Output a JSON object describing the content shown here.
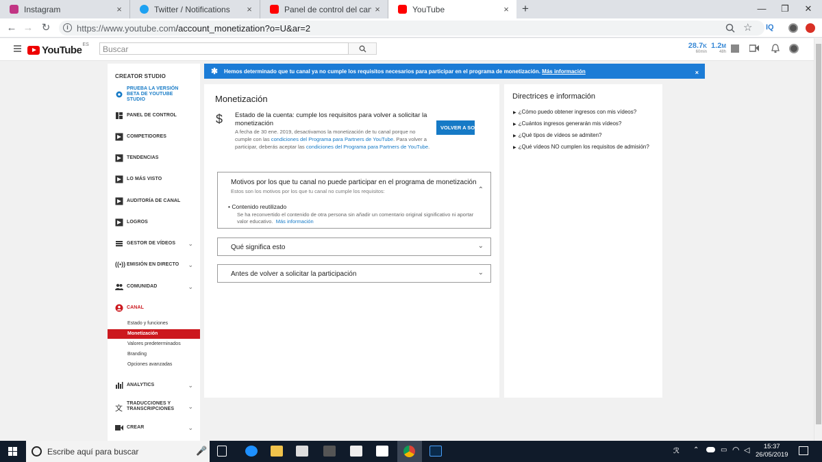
{
  "browser": {
    "tabs": [
      {
        "label": "Instagram",
        "favicon_color": "#c13584"
      },
      {
        "label": "Twitter / Notifications",
        "favicon_color": "#1da1f2"
      },
      {
        "label": "Panel de control del canal - YouTu",
        "favicon_color": "#ff0000"
      },
      {
        "label": "YouTube",
        "favicon_color": "#ff0000"
      }
    ],
    "close_glyph": "×",
    "new_tab_glyph": "+",
    "window_controls": [
      "—",
      "❐",
      "✕"
    ],
    "url_host": "https://www.youtube.com",
    "url_path": "/account_monetization?o=U&ar=2",
    "extension_label": "IQ"
  },
  "youtube": {
    "logo_text": "YouTube",
    "country_code": "ES",
    "search_placeholder": "Buscar",
    "stats": [
      {
        "value": "28.7",
        "unit": "K",
        "label": "60min"
      },
      {
        "value": "1.2",
        "unit": "M",
        "label": "48h"
      }
    ]
  },
  "sidebar": {
    "title": "CREATOR STUDIO",
    "beta_label": "PRUEBA LA VERSIÓN BETA DE YOUTUBE STUDIO",
    "items": [
      {
        "label": "PANEL DE CONTROL",
        "icon": "dashboard-icon"
      },
      {
        "label": "COMPETIDORES",
        "icon": "extension-icon"
      },
      {
        "label": "TENDENCIAS",
        "icon": "extension-icon"
      },
      {
        "label": "LO MÁS VISTO",
        "icon": "extension-icon"
      },
      {
        "label": "AUDITORÍA DE CANAL",
        "icon": "extension-icon"
      },
      {
        "label": "LOGROS",
        "icon": "extension-icon"
      },
      {
        "label": "GESTOR DE VÍDEOS",
        "icon": "video-manager-icon"
      },
      {
        "label": "EMISIÓN EN DIRECTO",
        "icon": "live-icon"
      },
      {
        "label": "COMUNIDAD",
        "icon": "community-icon"
      },
      {
        "label": "CANAL",
        "icon": "channel-icon"
      },
      {
        "label": "ANALYTICS",
        "icon": "analytics-icon"
      },
      {
        "label": "TRADUCCIONES Y TRANSCRIPCIONES",
        "icon": "translate-icon"
      },
      {
        "label": "CREAR",
        "icon": "create-icon"
      }
    ],
    "canal_subitems": [
      "Estado y funciones",
      "Monetización",
      "Valores predeterminados",
      "Branding",
      "Opciones avanzadas"
    ],
    "active_subitem": "Monetización"
  },
  "banner": {
    "text": "Hemos determinado que tu canal ya no cumple los requisitos necesarios para participar en el programa de monetización.",
    "link": "Más información",
    "close": "×",
    "color": "#1c7cd6"
  },
  "main": {
    "title": "Monetización",
    "status_title": "Estado de la cuenta: cumple los requisitos para volver a solicitar la monetización",
    "status_desc_1": "A fecha de 30 ene. 2019, desactivamos la monetización de tu canal porque no cumple con las ",
    "status_link_1": "condiciones del Programa para Partners de YouTube",
    "status_desc_2": ". Para volver a participar, deberás aceptar las ",
    "status_link_2": "condiciones del Programa para Partners de YouTube",
    "status_desc_3": ".",
    "reapply_button": "VOLVER A SO",
    "reasons_box": {
      "title": "Motivos por los que tu canal no puede participar en el programa de monetización",
      "subtitle": "Estos son los motivos por los que tu canal no cumple los requisitos:",
      "reason_title": "Contenido reutilizado",
      "reason_desc": "Se ha reconvertido el contenido de otra persona sin añadir un comentario original significativo ni aportar valor educativo.",
      "reason_link": "Más información"
    },
    "box2_title": "Qué significa esto",
    "box3_title": "Antes de volver a solicitar la participación"
  },
  "guidelines": {
    "title": "Directrices e información",
    "links": [
      "¿Cómo puedo obtener ingresos con mis vídeos?",
      "¿Cuántos ingresos generarán mis vídeos?",
      "¿Qué tipos de vídeos se admiten?",
      "¿Qué vídeos NO cumplen los requisitos de admisión?"
    ]
  },
  "taskbar": {
    "search_placeholder": "Escribe aquí para buscar",
    "time": "15:37",
    "date": "26/05/2019"
  }
}
